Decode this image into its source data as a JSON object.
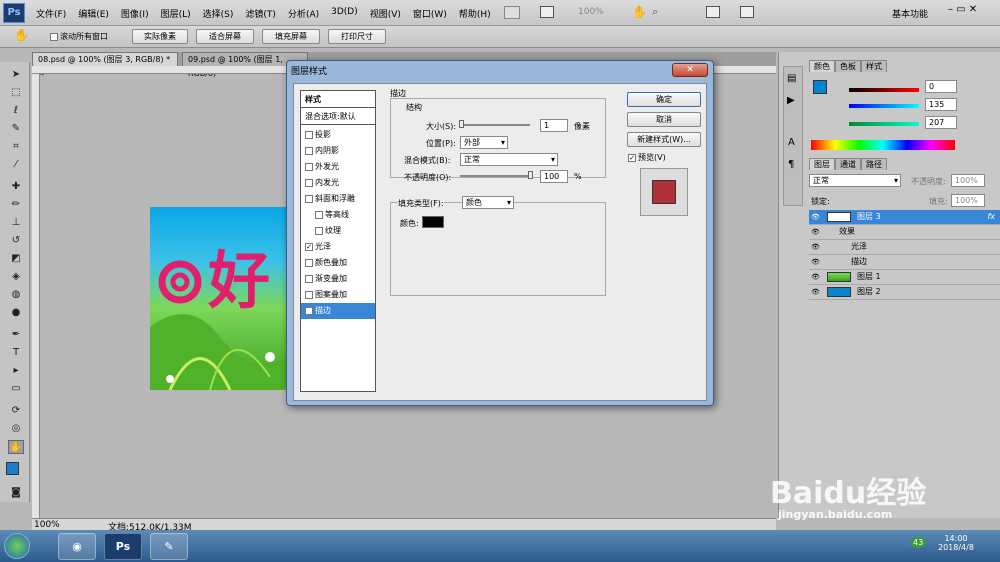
{
  "app": {
    "logo": "Ps",
    "workspace": "基本功能"
  },
  "menus": [
    "文件(F)",
    "编辑(E)",
    "图像(I)",
    "图层(L)",
    "选择(S)",
    "滤镜(T)",
    "分析(A)",
    "3D(D)",
    "视图(V)",
    "窗口(W)",
    "帮助(H)"
  ],
  "zoom_top": "100%",
  "options": {
    "scroll_all": "滚动所有窗口",
    "btn1": "实际像素",
    "btn2": "适合屏幕",
    "btn3": "填充屏幕",
    "btn4": "打印尺寸"
  },
  "doc_tabs": [
    "08.psd @ 100% (图层 3, RGB/8) *",
    "09.psd @ 100% (图层 1, RGB/8)"
  ],
  "status": {
    "zoom": "100%",
    "doc": "文档:512.0K/1.33M"
  },
  "canvas": {
    "glyph": "好"
  },
  "dialog": {
    "title": "图层样式",
    "close": "✕",
    "list_header": "样式",
    "blend_default": "混合选项:默认",
    "styles": [
      {
        "label": "投影",
        "checked": false
      },
      {
        "label": "内阴影",
        "checked": false
      },
      {
        "label": "外发光",
        "checked": false
      },
      {
        "label": "内发光",
        "checked": false
      },
      {
        "label": "斜面和浮雕",
        "checked": false
      },
      {
        "label": "等高线",
        "checked": false,
        "sub": true
      },
      {
        "label": "纹理",
        "checked": false,
        "sub": true
      },
      {
        "label": "光泽",
        "checked": true
      },
      {
        "label": "颜色叠加",
        "checked": false
      },
      {
        "label": "渐变叠加",
        "checked": false
      },
      {
        "label": "图案叠加",
        "checked": false
      },
      {
        "label": "描边",
        "checked": true,
        "selected": true
      }
    ],
    "section": "描边",
    "group": "结构",
    "size_label": "大小(S):",
    "size_value": "1",
    "size_unit": "像素",
    "pos_label": "位置(P):",
    "pos_value": "外部",
    "blend_label": "混合模式(B):",
    "blend_value": "正常",
    "opacity_label": "不透明度(O):",
    "opacity_value": "100",
    "opacity_unit": "%",
    "fill_label": "填充类型(F):",
    "fill_value": "颜色",
    "color_label": "颜色:",
    "ok": "确定",
    "cancel": "取消",
    "new_style": "新建样式(W)...",
    "preview": "预览(V)",
    "preview_color": "#b03038",
    "stroke_color": "#000000"
  },
  "panels": {
    "color_tabs": [
      "颜色",
      "色板",
      "样式"
    ],
    "color_values": [
      "0",
      "135",
      "207"
    ],
    "layer_tabs": [
      "图层",
      "通道",
      "路径"
    ],
    "blend": "正常",
    "opacity_label": "不透明度:",
    "opacity": "100%",
    "lock_label": "锁定:",
    "fill_label": "填充:",
    "fill": "100%",
    "layers": [
      {
        "name": "图层 3",
        "selected": true,
        "fx": "fx"
      },
      {
        "name": "效果",
        "indent": 1
      },
      {
        "name": "光泽",
        "indent": 2
      },
      {
        "name": "描边",
        "indent": 2
      },
      {
        "name": "图层 1"
      },
      {
        "name": "图层 2"
      }
    ]
  },
  "taskbar": {
    "ps_label": "Ps",
    "time": "14:00",
    "date": "2018/4/8",
    "badge": "43"
  },
  "watermark": {
    "logo": "Baidu经验",
    "url": "jingyan.baidu.com"
  }
}
